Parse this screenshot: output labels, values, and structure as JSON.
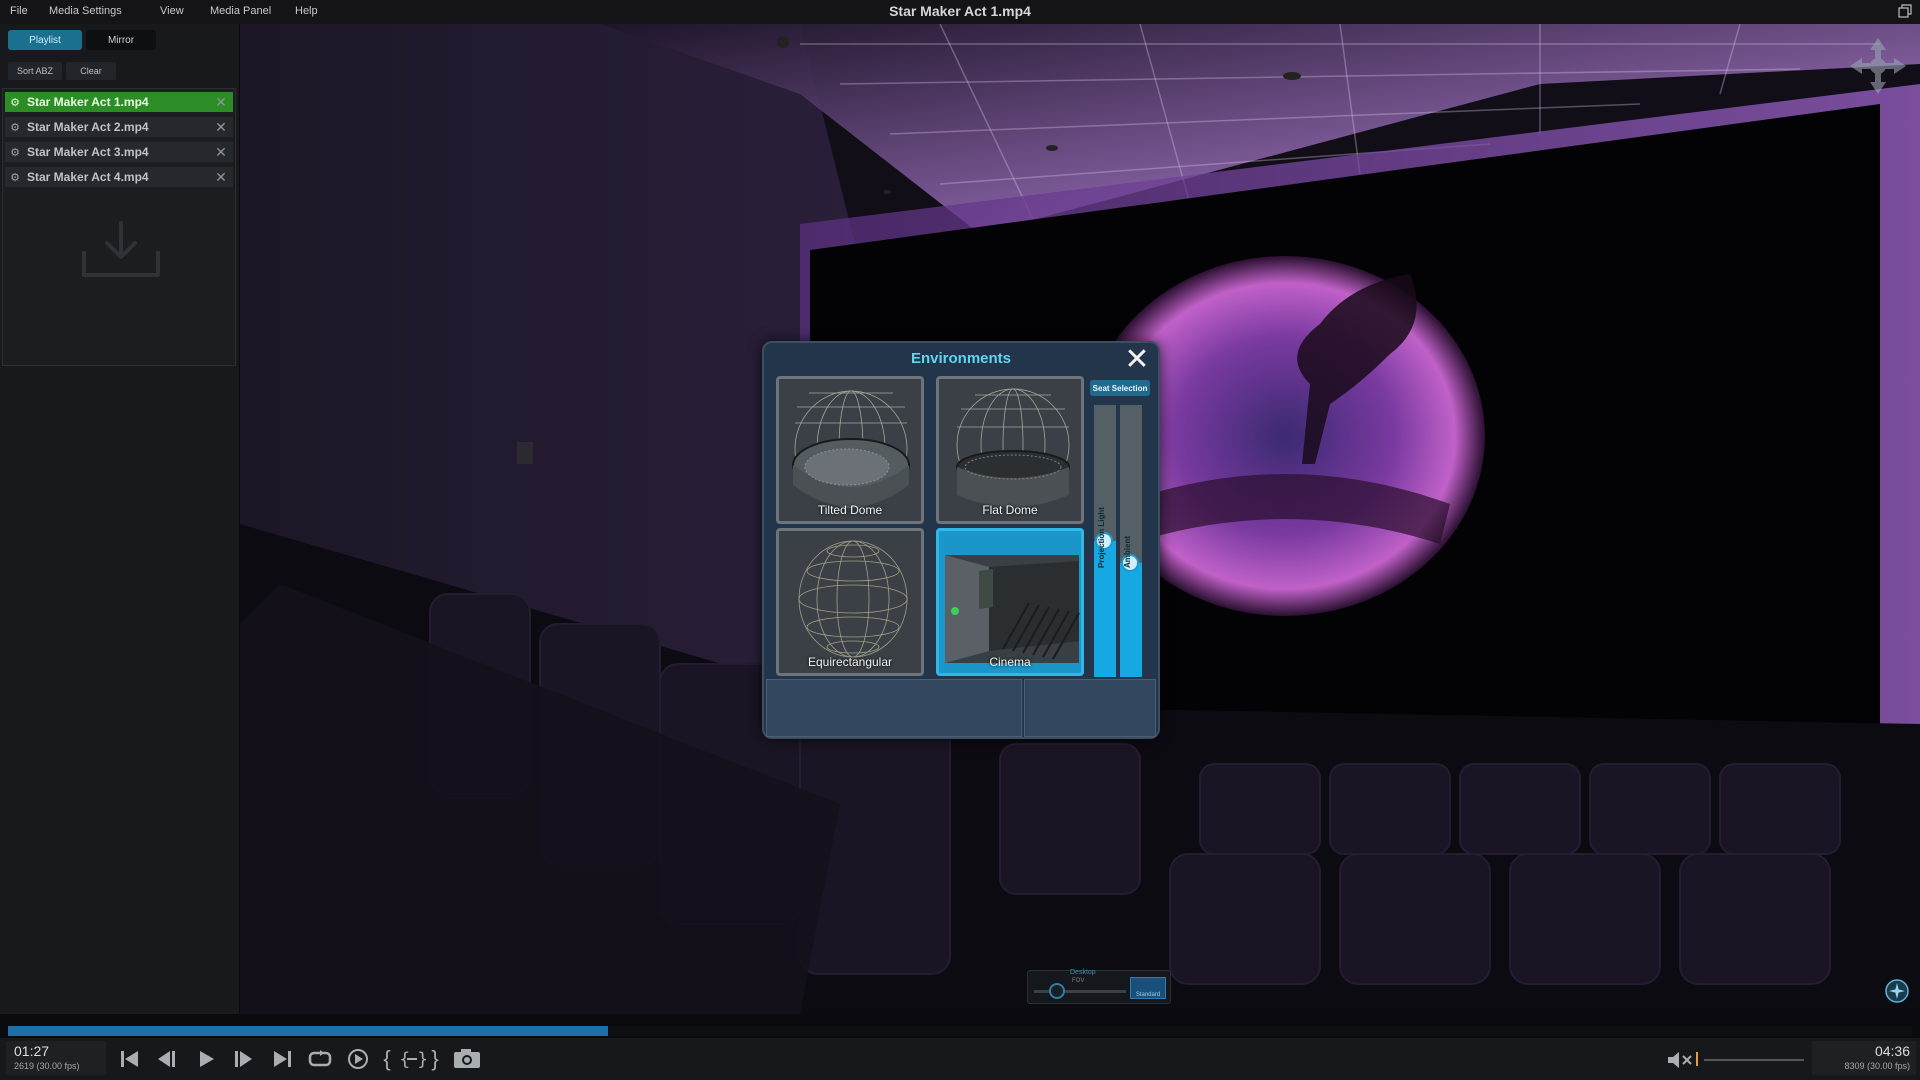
{
  "menu": {
    "file": "File",
    "media_settings": "Media Settings",
    "view": "View",
    "media_panel": "Media Panel",
    "help": "Help"
  },
  "window": {
    "title": "Star Maker Act 1.mp4"
  },
  "sidebar": {
    "tabs": {
      "playlist": "Playlist",
      "mirror": "Mirror"
    },
    "sort_label": "Sort ABZ",
    "clear_label": "Clear",
    "items": [
      {
        "label": "Star Maker Act 1.mp4",
        "active": true
      },
      {
        "label": "Star Maker Act 2.mp4",
        "active": false
      },
      {
        "label": "Star Maker Act 3.mp4",
        "active": false
      },
      {
        "label": "Star Maker Act 4.mp4",
        "active": false
      }
    ]
  },
  "environments": {
    "title": "Environments",
    "cards": [
      {
        "label": "Tilted Dome",
        "selected": false
      },
      {
        "label": "Flat Dome",
        "selected": false
      },
      {
        "label": "Equirectangular",
        "selected": false
      },
      {
        "label": "Cinema",
        "selected": true
      }
    ],
    "seat_selection_label": "Seat Selection",
    "sliders": [
      {
        "label": "Projection Light",
        "level": 0.5
      },
      {
        "label": "Ambient",
        "level": 0.42
      }
    ]
  },
  "fov_widget": {
    "mode_label": "Desktop",
    "fov_label": "FOV",
    "view_label": "Standard",
    "level": 0.25
  },
  "playback": {
    "current_time": "01:27",
    "current_frame": "2619 (30.00 fps)",
    "total_time": "04:36",
    "total_frames": "8309 (30.00 fps)",
    "progress": 0.315
  },
  "icons": {
    "move": "move-arrows-icon",
    "compass": "compass-icon",
    "prev": "skip-start-icon",
    "step_back": "step-back-icon",
    "play": "play-icon",
    "step_fwd": "step-forward-icon",
    "next": "skip-end-icon",
    "loop": "loop-icon",
    "autoplay": "autoplay-icon",
    "brace_left": "mark-in-icon",
    "brace_mid": "mark-range-icon",
    "brace_right": "mark-out-icon",
    "snapshot": "camera-icon",
    "volume": "volume-mute-icon"
  },
  "colors": {
    "accent": "#1b96c9",
    "active_item": "#2c8c26",
    "title_cyan": "#5fd6f0"
  }
}
